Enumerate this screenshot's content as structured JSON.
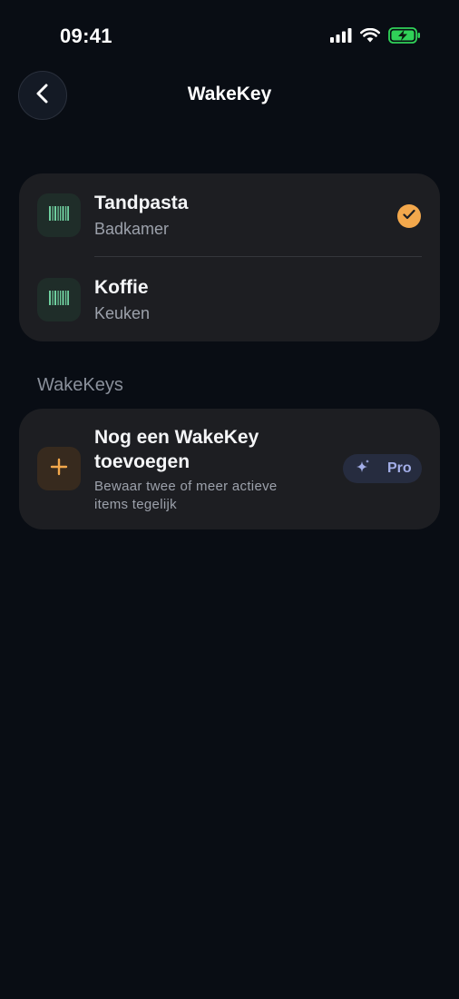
{
  "status_bar": {
    "time": "09:41"
  },
  "header": {
    "title": "WakeKey",
    "back_icon": "chevron-left-icon"
  },
  "items": [
    {
      "name": "Tandpasta",
      "location": "Badkamer",
      "icon": "barcode-icon",
      "selected": true
    },
    {
      "name": "Koffie",
      "location": "Keuken",
      "icon": "barcode-icon",
      "selected": false
    }
  ],
  "wakekeys_section": {
    "label": "WakeKeys",
    "add": {
      "title": "Nog een WakeKey toevoegen",
      "description": "Bewaar twee of meer actieve items tegelijk",
      "icon": "plus-icon",
      "badge_label": "Pro",
      "badge_icon": "sparkles-icon"
    }
  },
  "colors": {
    "background": "#090d14",
    "card": "#1d1e22",
    "accent_orange": "#f3a84c",
    "barcode_green": "#6fcf9f",
    "pro_text": "#a3aee8",
    "battery_green": "#30d158"
  }
}
